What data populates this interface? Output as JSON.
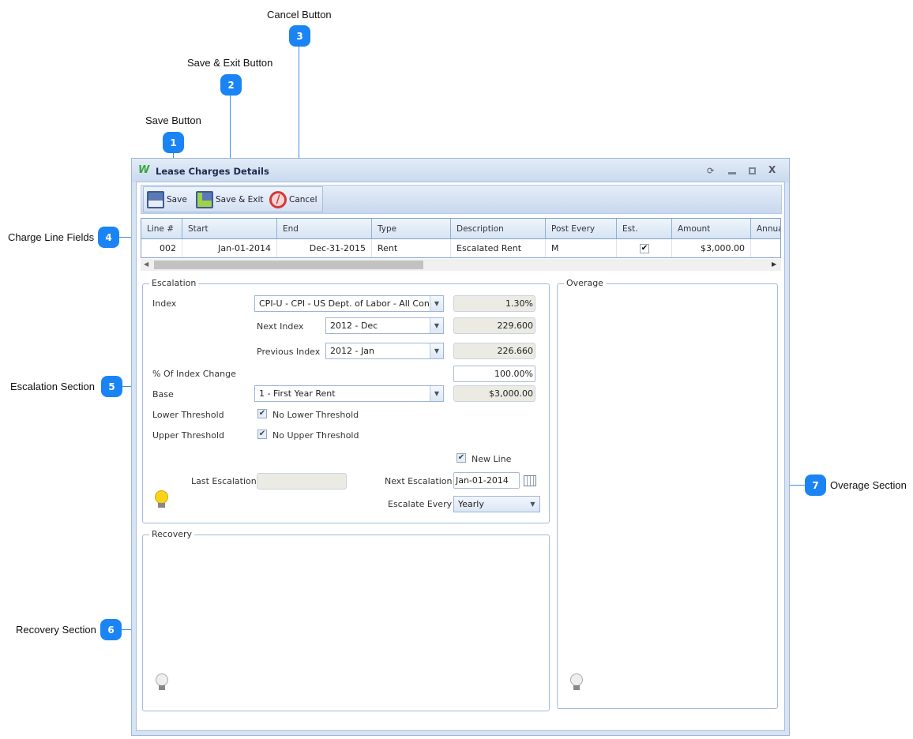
{
  "callouts": [
    {
      "num": "1",
      "label": "Save Button"
    },
    {
      "num": "2",
      "label": "Save & Exit Button"
    },
    {
      "num": "3",
      "label": "Cancel Button"
    },
    {
      "num": "4",
      "label": "Charge Line Fields"
    },
    {
      "num": "5",
      "label": "Escalation Section"
    },
    {
      "num": "6",
      "label": "Recovery Section"
    },
    {
      "num": "7",
      "label": "Overage Section"
    }
  ],
  "window": {
    "title": "Lease Charges Details",
    "controls": [
      "refresh-icon",
      "minimize-icon",
      "maximize-icon",
      "close-icon"
    ]
  },
  "toolbar": {
    "save": "Save",
    "save_exit": "Save & Exit",
    "cancel": "Cancel"
  },
  "grid": {
    "columns": [
      "Line #",
      "Start",
      "End",
      "Type",
      "Description",
      "Post Every",
      "Est.",
      "Amount",
      "Annua"
    ],
    "rows": [
      {
        "line": "002",
        "start": "Jan-01-2014",
        "end": "Dec-31-2015",
        "type": "Rent",
        "description": "Escalated Rent",
        "post_every": "M",
        "est": true,
        "amount": "$3,000.00",
        "annual": "$"
      }
    ]
  },
  "escalation": {
    "legend": "Escalation",
    "index_label": "Index",
    "index_value": "CPI-U - CPI - US Dept. of Labor - All Con",
    "index_pct": "1.30%",
    "next_index_label": "Next Index",
    "next_index_value": "2012 - Dec",
    "next_index_num": "229.600",
    "prev_index_label": "Previous Index",
    "prev_index_value": "2012 - Jan",
    "prev_index_num": "226.660",
    "pct_change_label": "% Of Index Change",
    "pct_change_value": "100.00%",
    "base_label": "Base",
    "base_value": "1 - First Year Rent",
    "base_amount": "$3,000.00",
    "lower_label": "Lower Threshold",
    "lower_cb": "No Lower Threshold",
    "upper_label": "Upper Threshold",
    "upper_cb": "No Upper Threshold",
    "new_line": "New Line",
    "last_esc_label": "Last Escalation",
    "last_esc_value": "",
    "next_esc_label": "Next Escalation",
    "next_esc_value": "Jan-01-2014",
    "esc_every_label": "Escalate Every",
    "esc_every_value": "Yearly"
  },
  "recovery": {
    "legend": "Recovery"
  },
  "overage": {
    "legend": "Overage"
  }
}
